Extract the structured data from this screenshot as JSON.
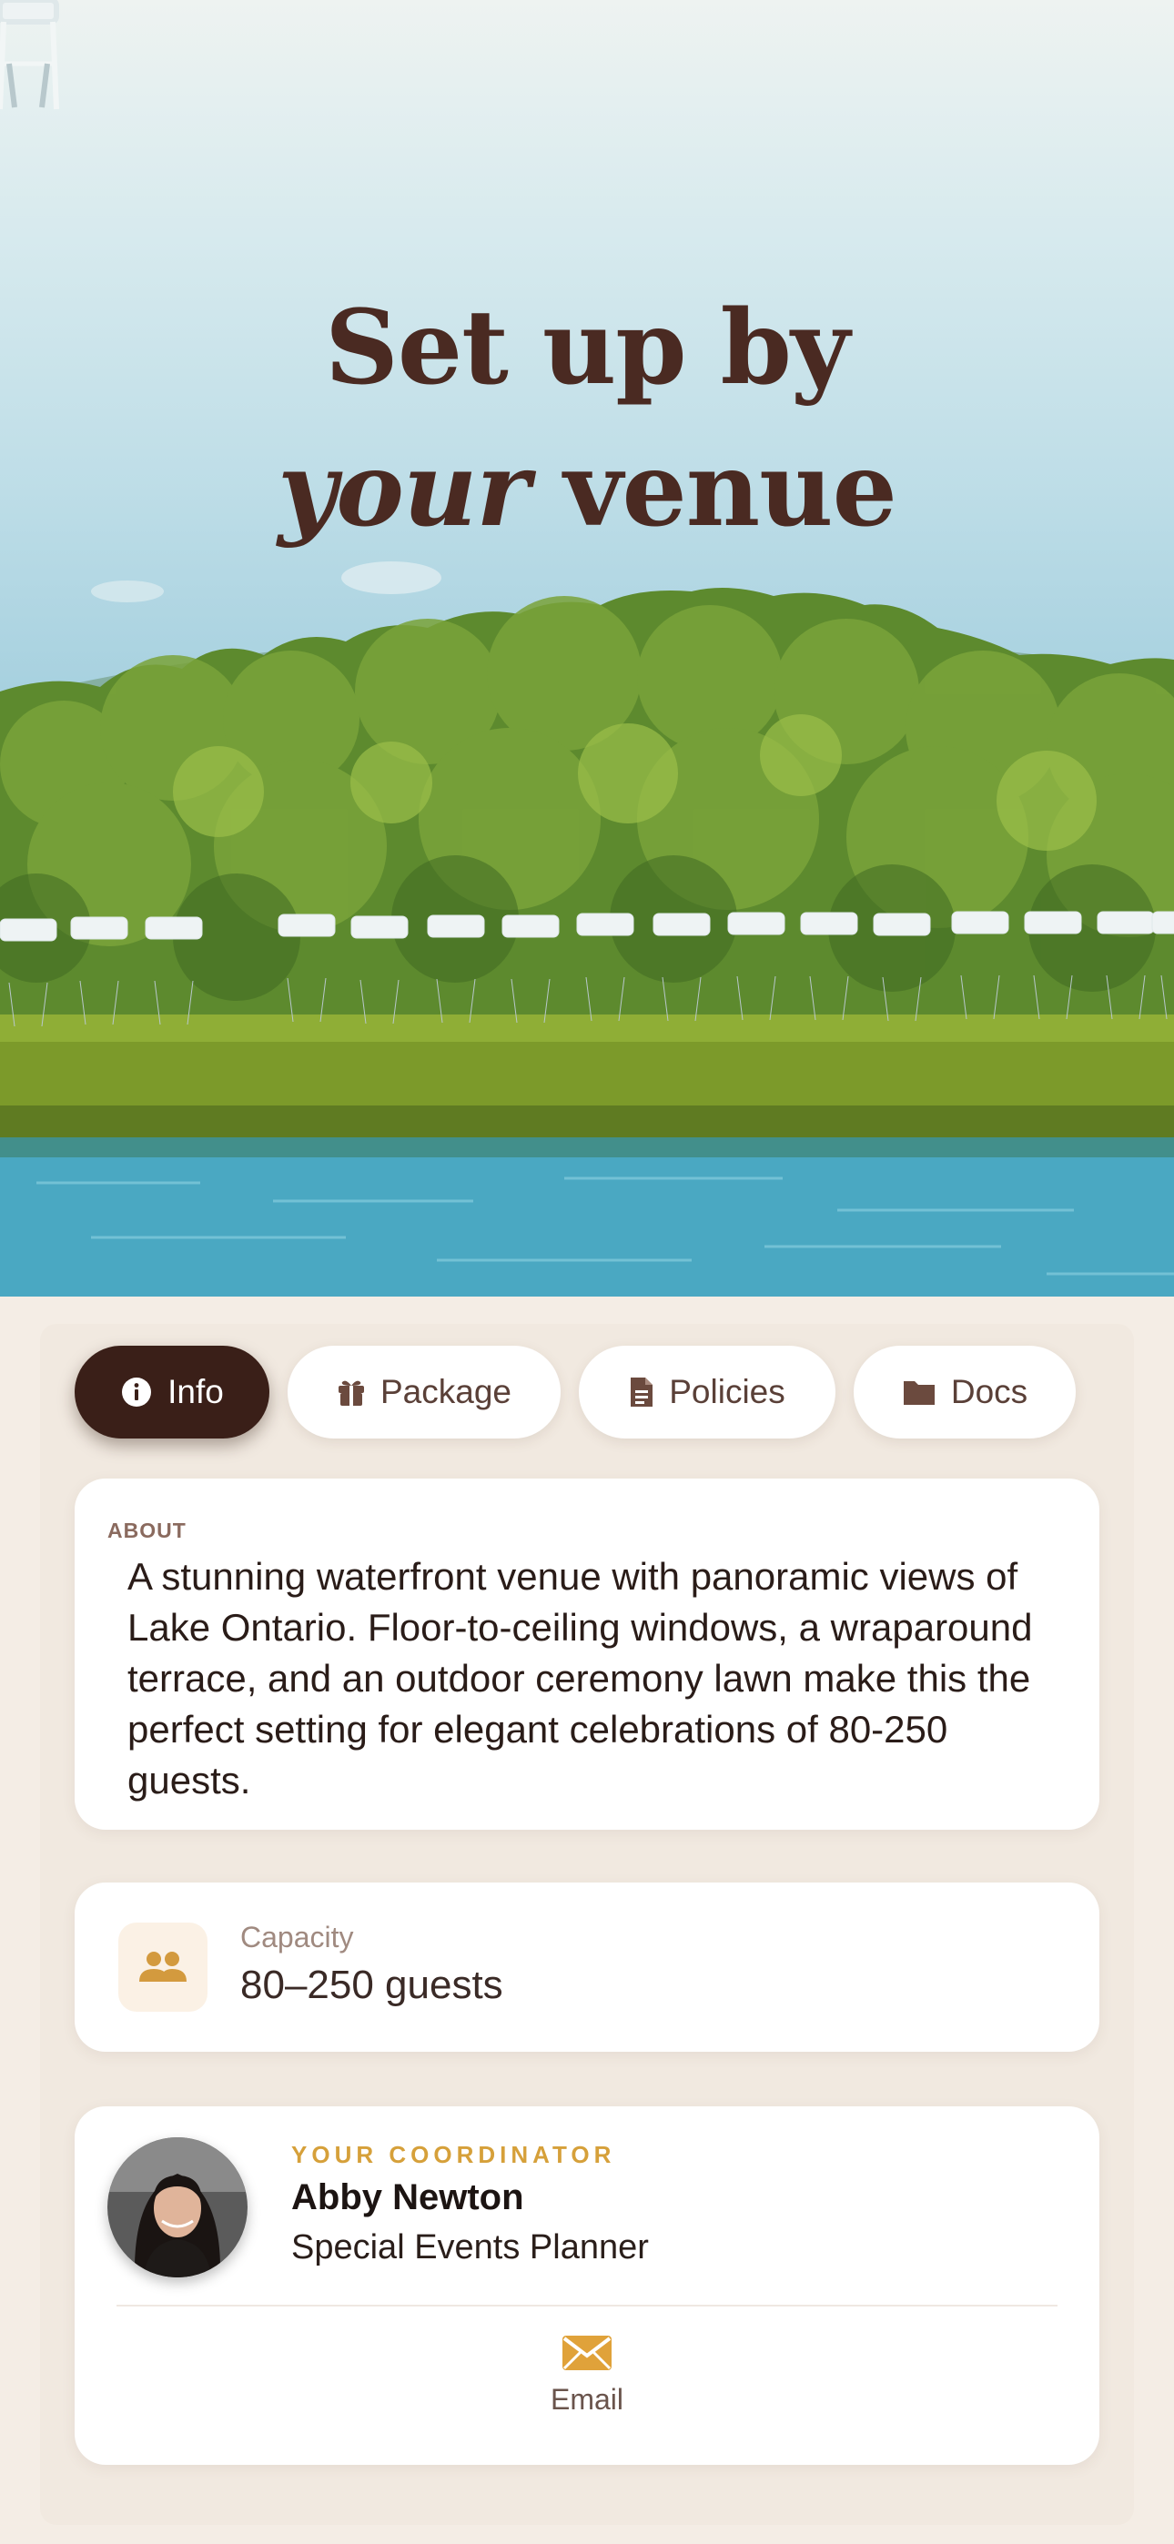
{
  "hero": {
    "title_line1": "Set up by",
    "title_italic": "your",
    "title_rest": " venue"
  },
  "tabs": [
    {
      "label": "Info",
      "icon": "info-icon",
      "active": true
    },
    {
      "label": "Package",
      "icon": "gift-icon",
      "active": false
    },
    {
      "label": "Policies",
      "icon": "document-icon",
      "active": false
    },
    {
      "label": "Docs",
      "icon": "folder-icon",
      "active": false
    }
  ],
  "about": {
    "label": "ABOUT",
    "text": "A stunning waterfront venue with panoramic views of Lake Ontario. Floor-to-ceiling windows, a wraparound terrace, and an outdoor ceremony lawn make this the perfect setting for elegant celebrations of 80-250 guests."
  },
  "capacity": {
    "label": "Capacity",
    "value": "80–250 guests",
    "icon": "people-icon"
  },
  "coordinator": {
    "label": "YOUR COORDINATOR",
    "name": "Abby Newton",
    "role": "Special Events Planner",
    "email_label": "Email",
    "email_icon": "envelope-icon"
  },
  "colors": {
    "accent_dark": "#3a1f18",
    "title_brown": "#4a2a22",
    "gold": "#d6a03a",
    "background": "#f4ede5"
  }
}
